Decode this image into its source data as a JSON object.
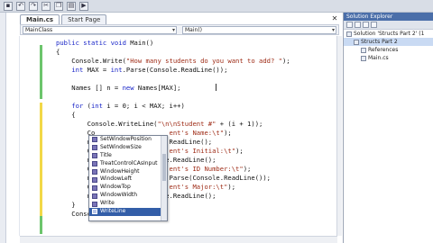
{
  "window": {
    "toolbar_buttons": [
      "save-icon",
      "undo-icon",
      "redo-icon",
      "cut-icon",
      "copy-icon",
      "paste-icon",
      "run-icon"
    ]
  },
  "tabs": [
    {
      "label": "Main.cs",
      "active": true
    },
    {
      "label": "Start Page",
      "active": false
    }
  ],
  "navbar": {
    "class_combo": "MainClass",
    "member_combo": "Main()"
  },
  "code": {
    "lines": [
      {
        "parts": [
          {
            "t": "public static void ",
            "c": "kw"
          },
          {
            "t": "Main()",
            "c": ""
          }
        ]
      },
      {
        "parts": [
          {
            "t": "{",
            "c": ""
          }
        ]
      },
      {
        "parts": [
          {
            "t": "    Console.Write(",
            "c": ""
          },
          {
            "t": "\"How many students do you want to add? \"",
            "c": "str"
          },
          {
            "t": ");",
            "c": ""
          }
        ]
      },
      {
        "parts": [
          {
            "t": "    ",
            "c": ""
          },
          {
            "t": "int",
            "c": "kw"
          },
          {
            "t": " MAX = ",
            "c": ""
          },
          {
            "t": "int",
            "c": "kw"
          },
          {
            "t": ".Parse(Console.ReadLine());",
            "c": ""
          }
        ]
      },
      {
        "parts": [
          {
            "t": "",
            "c": ""
          }
        ]
      },
      {
        "parts": [
          {
            "t": "    Names [] n = ",
            "c": ""
          },
          {
            "t": "new",
            "c": "kw"
          },
          {
            "t": " Names[MAX];",
            "c": ""
          }
        ]
      },
      {
        "parts": [
          {
            "t": "",
            "c": ""
          }
        ]
      },
      {
        "parts": [
          {
            "t": "    ",
            "c": ""
          },
          {
            "t": "for",
            "c": "kw"
          },
          {
            "t": " (",
            "c": ""
          },
          {
            "t": "int",
            "c": "kw"
          },
          {
            "t": " i = 0; i < MAX; i++)",
            "c": ""
          }
        ]
      },
      {
        "parts": [
          {
            "t": "    {",
            "c": ""
          }
        ]
      },
      {
        "parts": [
          {
            "t": "        Console.WriteLine(",
            "c": ""
          },
          {
            "t": "\"\\n\\nStudent #\"",
            "c": "str"
          },
          {
            "t": " + (i + 1));",
            "c": ""
          }
        ]
      },
      {
        "parts": [
          {
            "t": "        Co",
            "c": ""
          },
          {
            "t": "                   ent's Name:\\t\"",
            "c": "str"
          },
          {
            "t": ");",
            "c": ""
          }
        ]
      },
      {
        "parts": [
          {
            "t": "        n",
            "c": ""
          },
          {
            "t": "                   .ReadLine();",
            "c": ""
          }
        ]
      },
      {
        "parts": [
          {
            "t": "        Co",
            "c": ""
          },
          {
            "t": "                   ent's Initial:\\t\"",
            "c": "str"
          },
          {
            "t": ");",
            "c": ""
          }
        ]
      },
      {
        "parts": [
          {
            "t": "        n",
            "c": ""
          },
          {
            "t": "                   e.ReadLine();",
            "c": ""
          }
        ]
      },
      {
        "parts": [
          {
            "t": "        Co",
            "c": ""
          },
          {
            "t": "                   ent's ID Number:\\t\"",
            "c": "str"
          },
          {
            "t": ");",
            "c": ""
          }
        ]
      },
      {
        "parts": [
          {
            "t": "        n",
            "c": ""
          },
          {
            "t": "                   .Parse(Console.ReadLine());",
            "c": ""
          }
        ]
      },
      {
        "parts": [
          {
            "t": "        Co",
            "c": ""
          },
          {
            "t": "                   ent's Major:\\t\"",
            "c": "str"
          },
          {
            "t": ");",
            "c": ""
          }
        ]
      },
      {
        "parts": [
          {
            "t": "        n",
            "c": ""
          },
          {
            "t": "                   e.ReadLine();",
            "c": ""
          }
        ]
      },
      {
        "parts": [
          {
            "t": "    }",
            "c": ""
          }
        ]
      },
      {
        "parts": [
          {
            "t": "    Console.",
            "c": ""
          }
        ]
      }
    ]
  },
  "intellisense": {
    "items": [
      {
        "label": "SetWindowPosition",
        "selected": false
      },
      {
        "label": "SetWindowSize",
        "selected": false
      },
      {
        "label": "Title",
        "selected": false
      },
      {
        "label": "TreatControlCAsInput",
        "selected": false
      },
      {
        "label": "WindowHeight",
        "selected": false
      },
      {
        "label": "WindowLeft",
        "selected": false
      },
      {
        "label": "WindowTop",
        "selected": false
      },
      {
        "label": "WindowWidth",
        "selected": false
      },
      {
        "label": "Write",
        "selected": false
      },
      {
        "label": "WriteLine",
        "selected": true
      }
    ]
  },
  "solution_explorer": {
    "title": "Solution Explorer",
    "items": [
      {
        "label": "Solution 'Structs Part 2' (1",
        "indent": 0,
        "selected": false
      },
      {
        "label": "Structs Part 2",
        "indent": 1,
        "selected": true
      },
      {
        "label": "References",
        "indent": 2,
        "selected": false
      },
      {
        "label": "Main.cs",
        "indent": 2,
        "selected": false
      }
    ]
  }
}
